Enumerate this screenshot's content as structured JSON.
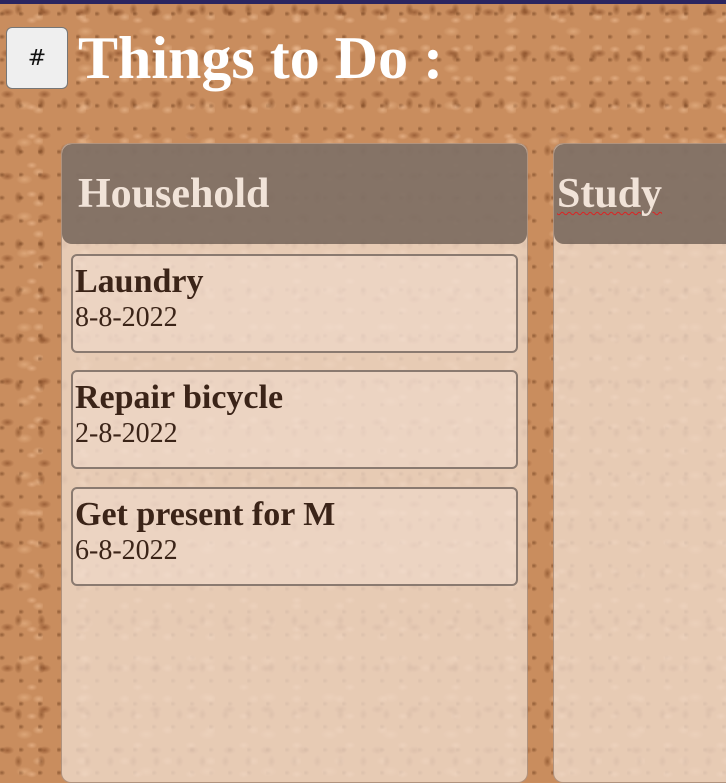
{
  "page": {
    "title": "Things to Do :",
    "menu_button_label": "#"
  },
  "columns": [
    {
      "title": "Household",
      "tasks": [
        {
          "title": "Laundry",
          "date": "8-8-2022"
        },
        {
          "title": "Repair bicycle",
          "date": "2-8-2022"
        },
        {
          "title": "Get present for M",
          "date": "6-8-2022"
        }
      ]
    },
    {
      "title": "Study",
      "tasks": []
    }
  ],
  "colors": {
    "top_bar": "#2a2560",
    "column_header": "#695a50",
    "task_text": "#3b2418",
    "spellcheck_underline": "#d22"
  }
}
